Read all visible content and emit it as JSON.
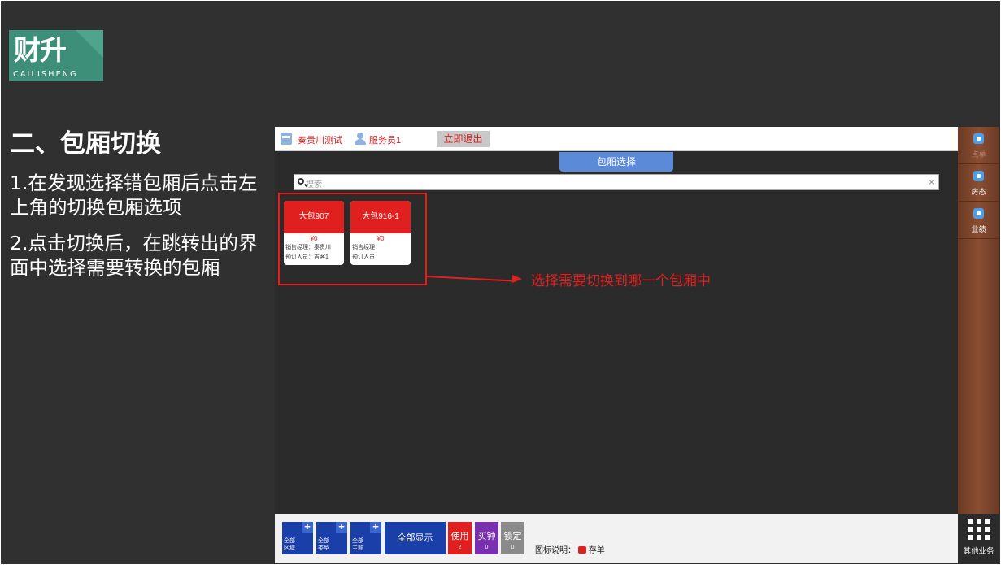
{
  "logo": {
    "main": "财升",
    "sub": "CAILISHENG"
  },
  "slide": {
    "heading": "二、包厢切换",
    "step1": "1.在发现选择错包厢后点击左上角的切换包厢选项",
    "step2": "2.点击切换后，在跳转出的界面中选择需要转换的包厢"
  },
  "app": {
    "topbar": {
      "store": "秦贵川测试",
      "waiter": "服务员1",
      "logout": "立即退出"
    },
    "room_select_tab": "包厢选择",
    "search": {
      "placeholder": "搜索",
      "clear": "×"
    },
    "rooms": [
      {
        "name": "大包907",
        "price": "¥0",
        "manager": "销售经理：秦贵川",
        "booker": "预订人员：吉客1"
      },
      {
        "name": "大包916-1",
        "price": "¥0",
        "manager": "销售经理：",
        "booker": "预订人员："
      }
    ],
    "annotation": "选择需要切换到哪一个包厢中",
    "sidebar": [
      {
        "label": "点单",
        "icon": "order-icon"
      },
      {
        "label": "房态",
        "icon": "room-status-icon"
      },
      {
        "label": "业绩",
        "icon": "performance-icon"
      }
    ],
    "sidebar_more": "其他业务",
    "bottom": {
      "filters": [
        {
          "l1": "全部",
          "l2": "区域"
        },
        {
          "l1": "全部",
          "l2": "类型"
        },
        {
          "l1": "全部",
          "l2": "主题"
        }
      ],
      "show_all": "全部显示",
      "status": [
        {
          "label": "使用",
          "count": "2",
          "color": "#e01f1f"
        },
        {
          "label": "买钟",
          "count": "0",
          "color": "#7a2fb0"
        },
        {
          "label": "锁定",
          "count": "0",
          "color": "#8a8a8a"
        }
      ],
      "legend_label": "图标说明：",
      "legend_item": "存单"
    }
  }
}
